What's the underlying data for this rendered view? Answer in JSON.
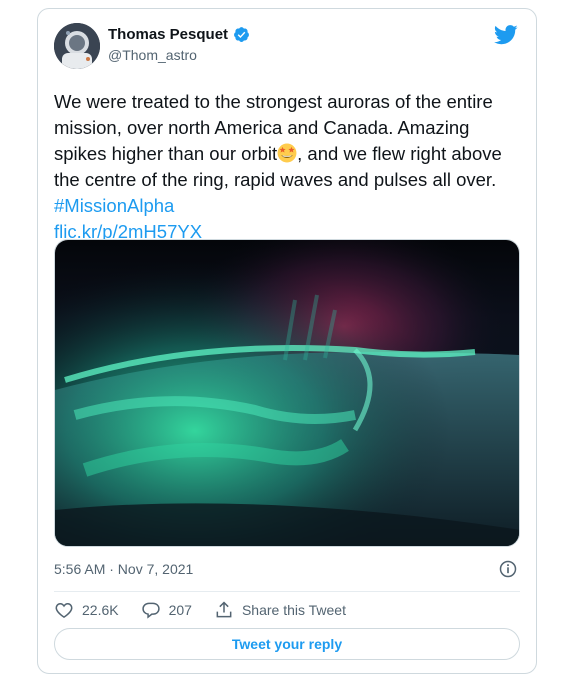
{
  "author": {
    "name": "Thomas Pesquet",
    "handle": "@Thom_astro",
    "verified": true
  },
  "tweet": {
    "text_before_emoji": "We were treated to the strongest auroras of the entire mission, over north America and Canada. Amazing spikes higher than our orbit",
    "emoji": "star-struck",
    "text_after_emoji": ", and we flew right above the centre of the ring, rapid waves and pulses all over. ",
    "hashtag": "#MissionAlpha",
    "link": "flic.kr/p/2mH57YX"
  },
  "media": {
    "icon": "aurora-photo"
  },
  "timestamp": "5:56 AM · Nov 7, 2021",
  "actions": {
    "likes": "22.6K",
    "replies": "207",
    "share_label": "Share this Tweet"
  },
  "reply_button": "Tweet your reply",
  "colors": {
    "accent": "#1d9bf0",
    "text": "#0f1419",
    "muted": "#536471",
    "border": "#cfd9de"
  }
}
